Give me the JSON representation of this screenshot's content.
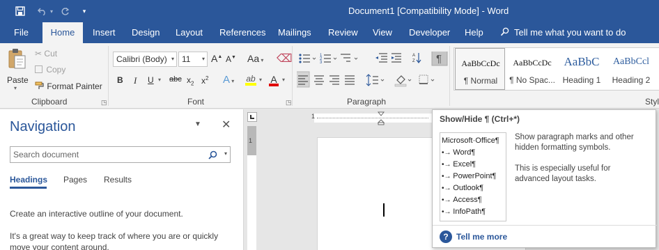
{
  "window": {
    "title": "Document1 [Compatibility Mode]  -  Word"
  },
  "qat": {
    "save_icon": "save-icon",
    "undo_icon": "undo-icon",
    "redo_icon": "redo-icon",
    "customize_glyph": "▾"
  },
  "tabs": [
    "File",
    "Home",
    "Insert",
    "Design",
    "Layout",
    "References",
    "Mailings",
    "Review",
    "View",
    "Developer",
    "Help"
  ],
  "active_tab": "Home",
  "tell_me": {
    "placeholder": "Tell me what you want to do"
  },
  "clipboard": {
    "paste": "Paste",
    "cut": "Cut",
    "copy": "Copy",
    "format_painter": "Format Painter",
    "label": "Clipboard"
  },
  "font": {
    "name": "Calibri (Body)",
    "size": "11",
    "grow": "A",
    "shrink": "A",
    "case": "Aa",
    "bold": "B",
    "italic": "I",
    "underline": "U",
    "strike": "abc",
    "subscript": "x",
    "subscript_mark": "2",
    "superscript": "x",
    "superscript_mark": "2",
    "text_effects": "A",
    "highlight": "ab",
    "font_color": "A",
    "label": "Font"
  },
  "paragraph": {
    "show_hide_glyph": "¶",
    "label": "Paragraph"
  },
  "styles": {
    "items": [
      {
        "sample": "AaBbCcDc",
        "name": "¶ Normal"
      },
      {
        "sample": "AaBbCcDc",
        "name": "¶ No Spac..."
      },
      {
        "sample": "AaBbC",
        "name": "Heading 1"
      },
      {
        "sample": "AaBbCcl",
        "name": "Heading 2"
      }
    ],
    "label": "Styl"
  },
  "navigation": {
    "title": "Navigation",
    "search_placeholder": "Search document",
    "tabs": [
      "Headings",
      "Pages",
      "Results"
    ],
    "active_tab": "Headings",
    "body_line1": "Create an interactive outline of your document.",
    "body_line2": "It's a great way to keep track of where you are or quickly",
    "body_line3": "move your content around."
  },
  "ruler": {
    "top_numbers": [
      "1"
    ],
    "left_numbers": [
      "1"
    ]
  },
  "tooltip": {
    "title": "Show/Hide ¶ (Ctrl+*)",
    "list": [
      "Microsoft·Office¶",
      "Word¶",
      "Excel¶",
      "PowerPoint¶",
      "Outlook¶",
      "Access¶",
      "InfoPath¶"
    ],
    "description": "Show paragraph marks and other hidden formatting symbols.",
    "description_line1": "Show paragraph marks and other",
    "description_line2": "hidden formatting symbols.",
    "extra_line1": "This is especially useful for",
    "extra_line2": "advanced layout tasks.",
    "help_link": "Tell me more"
  },
  "colors": {
    "brand": "#2b579a",
    "highlight": "#ffff00",
    "font_color": "#e00000",
    "show_hide_active": "#c5c5c5"
  }
}
